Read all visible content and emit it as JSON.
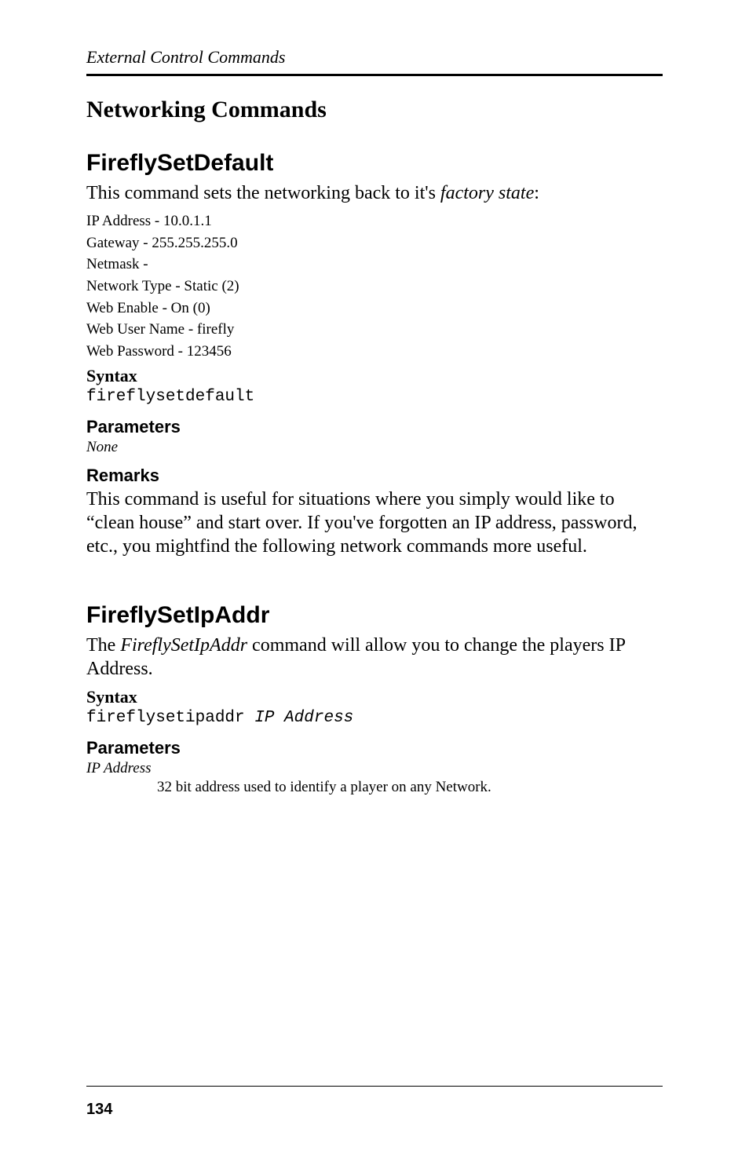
{
  "header": {
    "chapter": "External Control Commands"
  },
  "section": {
    "title": "Networking Commands"
  },
  "cmd1": {
    "title": "FireflySetDefault",
    "intro_a": "This command sets the networking back to it's ",
    "intro_b": "factory state",
    "intro_c": ":",
    "lines": {
      "l1": "IP Address - 10.0.1.1",
      "l2": "Gateway - 255.255.255.0",
      "l3": "Netmask -",
      "l4": "Network Type - Static (2)",
      "l5": "Web Enable - On (0)",
      "l6": "Web User Name - firefly",
      "l7": "Web Password - 123456"
    },
    "syntax_label": "Syntax",
    "syntax_code": "fireflysetdefault",
    "params_heading": "Parameters",
    "params_none": "None",
    "remarks_heading": "Remarks",
    "remarks_body": "This command is useful for situations where you simply would like to “clean house” and start over. If you've forgotten an IP address, password, etc., you mightfind the following network commands more useful."
  },
  "cmd2": {
    "title": "FireflySetIpAddr",
    "intro_a": "The ",
    "intro_b": "FireflySetIpAddr",
    "intro_c": " command will allow you to change the players  IP Address.",
    "syntax_label": "Syntax",
    "syntax_code_a": "fireflysetipaddr ",
    "syntax_code_b": "IP Address",
    "params_heading": "Parameters",
    "param_name": "IP Address",
    "param_desc": "32 bit address used to identify a player on any Network."
  },
  "footer": {
    "page": "134"
  }
}
